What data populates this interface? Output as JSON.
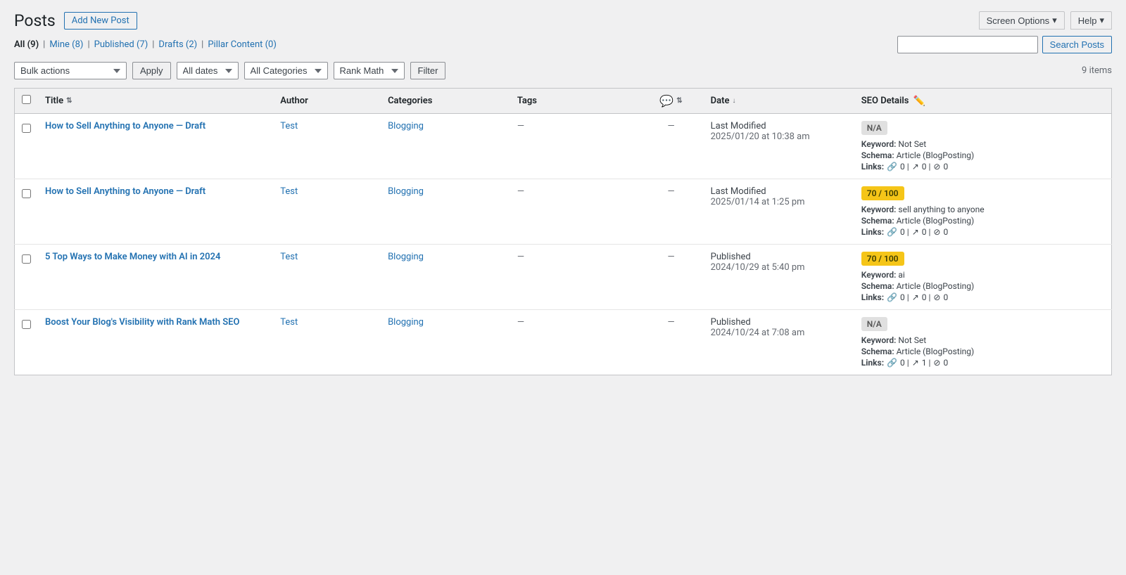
{
  "header": {
    "title": "Posts",
    "add_new_label": "Add New Post",
    "screen_options_label": "Screen Options",
    "help_label": "Help"
  },
  "filter_links": [
    {
      "label": "All",
      "count": 9,
      "href": "#all",
      "current": true
    },
    {
      "label": "Mine",
      "count": 8,
      "href": "#mine",
      "current": false
    },
    {
      "label": "Published",
      "count": 7,
      "href": "#published",
      "current": false
    },
    {
      "label": "Drafts",
      "count": 2,
      "href": "#drafts",
      "current": false
    },
    {
      "label": "Pillar Content",
      "count": 0,
      "href": "#pillar",
      "current": false
    }
  ],
  "search": {
    "placeholder": "",
    "button_label": "Search Posts"
  },
  "toolbar": {
    "bulk_actions_label": "Bulk actions",
    "apply_label": "Apply",
    "dates_label": "All dates",
    "categories_label": "All Categories",
    "rank_math_label": "Rank Math",
    "filter_label": "Filter",
    "items_count": "9 items"
  },
  "table": {
    "columns": {
      "title": "Title",
      "author": "Author",
      "categories": "Categories",
      "tags": "Tags",
      "comments": "💬",
      "date": "Date",
      "seo": "SEO Details"
    },
    "rows": [
      {
        "id": 1,
        "title": "How to Sell Anything to Anyone — Draft",
        "author": "Test",
        "categories": "Blogging",
        "tags": "—",
        "comments": "—",
        "date_status": "Last Modified",
        "date_value": "2025/01/20 at 10:38 am",
        "seo_score": "N/A",
        "seo_score_type": "na",
        "keyword": "Not Set",
        "schema": "Article (BlogPosting)",
        "links_internal": 0,
        "links_external": 0,
        "links_other": 0
      },
      {
        "id": 2,
        "title": "How to Sell Anything to Anyone — Draft",
        "author": "Test",
        "categories": "Blogging",
        "tags": "—",
        "comments": "—",
        "date_status": "Last Modified",
        "date_value": "2025/01/14 at 1:25 pm",
        "seo_score": "70 / 100",
        "seo_score_type": "score-70",
        "keyword": "sell anything to anyone",
        "schema": "Article (BlogPosting)",
        "links_internal": 0,
        "links_external": 0,
        "links_other": 0
      },
      {
        "id": 3,
        "title": "5 Top Ways to Make Money with AI in 2024",
        "author": "Test",
        "categories": "Blogging",
        "tags": "—",
        "comments": "—",
        "date_status": "Published",
        "date_value": "2024/10/29 at 5:40 pm",
        "seo_score": "70 / 100",
        "seo_score_type": "score-70",
        "keyword": "ai",
        "schema": "Article (BlogPosting)",
        "links_internal": 0,
        "links_external": 0,
        "links_other": 0
      },
      {
        "id": 4,
        "title": "Boost Your Blog's Visibility with Rank Math SEO",
        "author": "Test",
        "categories": "Blogging",
        "tags": "—",
        "comments": "—",
        "date_status": "Published",
        "date_value": "2024/10/24 at 7:08 am",
        "seo_score": "N/A",
        "seo_score_type": "na",
        "keyword": "Not Set",
        "schema": "Article (BlogPosting)",
        "links_internal": 0,
        "links_external": 1,
        "links_other": 0
      }
    ]
  }
}
